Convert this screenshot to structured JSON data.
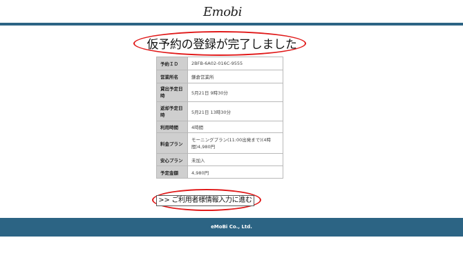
{
  "header": {
    "logo_text": "Emobi"
  },
  "title": "仮予約の登録が完了しました",
  "reservation": {
    "rows": [
      {
        "label": "予約ＩＤ",
        "value": "2BFB-6A02-016C-9555"
      },
      {
        "label": "営業所名",
        "value": "鎌倉営業所"
      },
      {
        "label": "貸出予定日時",
        "value": "5月21日 9時30分"
      },
      {
        "label": "返却予定日時",
        "value": "5月21日 13時30分"
      },
      {
        "label": "利用時間",
        "value": "4時間"
      },
      {
        "label": "料金プラン",
        "value": "モーニングプラン(11:00出発まで)(4時間)4,980円"
      },
      {
        "label": "安心プラン",
        "value": "未加入"
      },
      {
        "label": "予定金額",
        "value": "4,980円"
      }
    ]
  },
  "next_button": {
    "label": ">> ご利用者様情報入力に進む"
  },
  "footer": {
    "text": "eMoBi Co., Ltd."
  },
  "colors": {
    "brand": "#2c6484",
    "annotation": "#e01818",
    "label_bg": "#cfcfcf"
  }
}
